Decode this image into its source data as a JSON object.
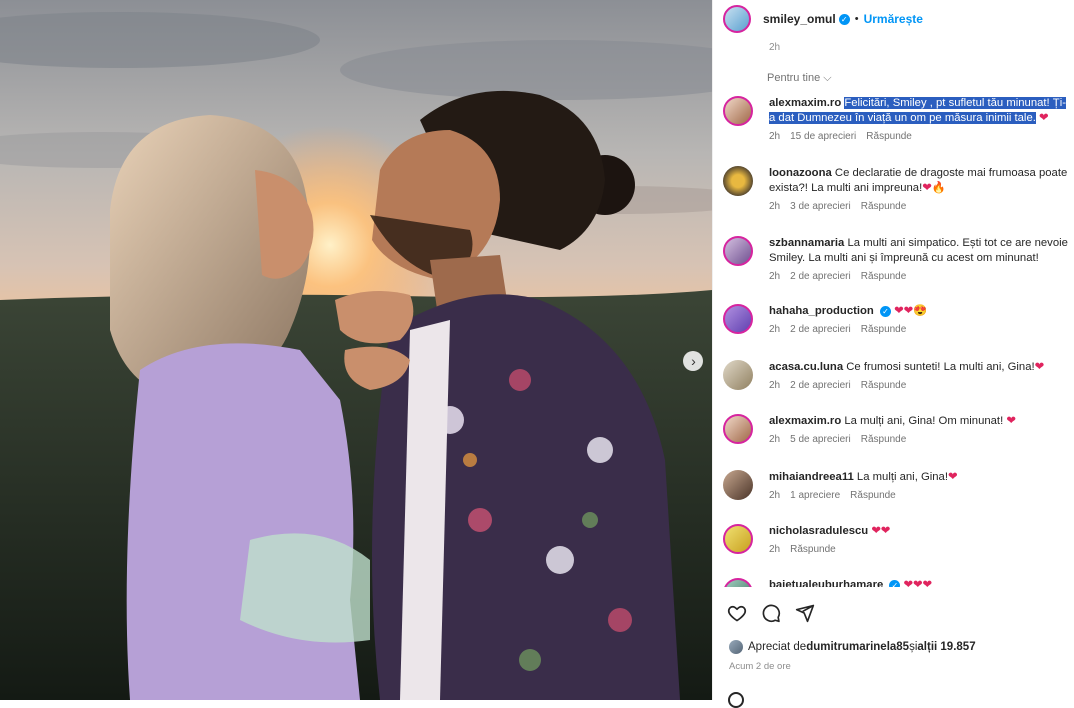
{
  "post": {
    "username": "smiley_omul",
    "follow_label": "Urmărește",
    "separator": "•",
    "time": "2h"
  },
  "sort_label": "Pentru tine",
  "comments": [
    {
      "user": "alexmaxim.ro",
      "text": "Felicitări, Smiley , pt sufletul tău minunat! Ți-a dat Dumnezeu în viață un om pe măsura inimii tale.",
      "emoji": "❤",
      "time": "2h",
      "likes": "15 de aprecieri",
      "reply": "Răspunde",
      "highlighted": true
    },
    {
      "user": "loonazoona",
      "text": "Ce declaratie de dragoste mai frumoasa poate exista?! La multi ani impreuna!",
      "emoji": "❤🔥",
      "time": "2h",
      "likes": "3 de aprecieri",
      "reply": "Răspunde"
    },
    {
      "user": "szbannamaria",
      "text": "La multi ani simpatico. Ești tot ce are nevoie Smiley. La multi ani și împreună cu acest om minunat!",
      "emoji": "",
      "time": "2h",
      "likes": "2 de aprecieri",
      "reply": "Răspunde"
    },
    {
      "user": "hahaha_production",
      "text": "",
      "emoji": "❤❤😍",
      "time": "2h",
      "likes": "2 de aprecieri",
      "reply": "Răspunde",
      "verified": true
    },
    {
      "user": "acasa.cu.luna",
      "text": "Ce frumosi sunteti! La multi ani, Gina!",
      "emoji": "❤",
      "time": "2h",
      "likes": "2 de aprecieri",
      "reply": "Răspunde"
    },
    {
      "user": "alexmaxim.ro",
      "text": "La mulți ani, Gina! Om minunat!",
      "emoji": "❤",
      "time": "2h",
      "likes": "5 de aprecieri",
      "reply": "Răspunde"
    },
    {
      "user": "mihaiandreea11",
      "text": "La mulți ani, Gina!",
      "emoji": "❤",
      "time": "2h",
      "likes": "1 apreciere",
      "reply": "Răspunde"
    },
    {
      "user": "nicholasradulescu",
      "text": "",
      "emoji": "❤❤",
      "time": "2h",
      "likes": "",
      "reply": "Răspunde"
    },
    {
      "user": "bajetualeuburhamare",
      "text": "",
      "emoji": "❤❤❤",
      "time": "",
      "likes": "",
      "reply": "",
      "verified": true
    }
  ],
  "likes": {
    "prefix": "Apreciat de ",
    "user": "dumitrumarinela85",
    "middle": " și ",
    "others": "alții 19.857"
  },
  "posted_ago": "Acum 2 de ore",
  "colors": {
    "accent": "#0095f6",
    "highlight": "#2b5ebf",
    "heart": "#e0245e"
  },
  "icons": [
    "heart-icon",
    "comment-icon",
    "share-icon",
    "chevron-right-icon",
    "chevron-down-icon",
    "verified-icon"
  ]
}
